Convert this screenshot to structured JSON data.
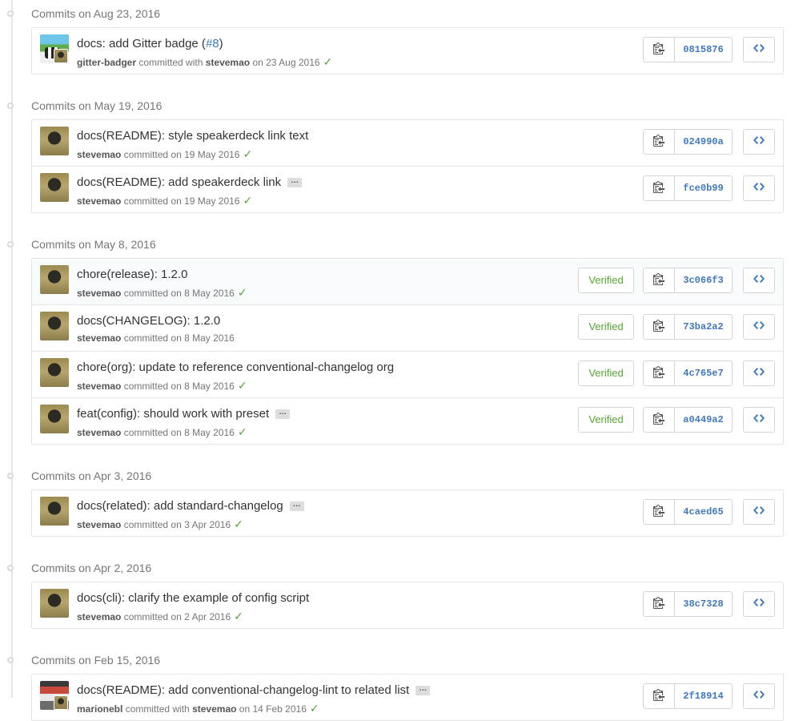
{
  "groups": [
    {
      "header": "Commits on Aug 23, 2016",
      "commits": [
        {
          "avatar": "gitter-badger",
          "title": "docs: add Gitter badge (",
          "issue": "#8",
          "title_suffix": ")",
          "expander": false,
          "author": "gitter-badger",
          "action": "committed with",
          "coauthor": "stevemao",
          "date": "on 23 Aug 2016",
          "check": true,
          "verified": false,
          "sha": "0815876",
          "highlight": false
        }
      ]
    },
    {
      "header": "Commits on May 19, 2016",
      "commits": [
        {
          "avatar": "stevemao",
          "title": "docs(README): style speakerdeck link text",
          "expander": false,
          "author": "stevemao",
          "action": "committed",
          "date": "on 19 May 2016",
          "check": true,
          "verified": false,
          "sha": "024990a",
          "highlight": false
        },
        {
          "avatar": "stevemao",
          "title": "docs(README): add speakerdeck link",
          "expander": true,
          "author": "stevemao",
          "action": "committed",
          "date": "on 19 May 2016",
          "check": true,
          "verified": false,
          "sha": "fce0b99",
          "highlight": false
        }
      ]
    },
    {
      "header": "Commits on May 8, 2016",
      "commits": [
        {
          "avatar": "stevemao",
          "title": "chore(release): 1.2.0",
          "expander": false,
          "author": "stevemao",
          "action": "committed",
          "date": "on 8 May 2016",
          "check": true,
          "verified": true,
          "sha": "3c066f3",
          "highlight": true
        },
        {
          "avatar": "stevemao",
          "title": "docs(CHANGELOG): 1.2.0",
          "expander": false,
          "author": "stevemao",
          "action": "committed",
          "date": "on 8 May 2016",
          "check": false,
          "verified": true,
          "sha": "73ba2a2",
          "highlight": false
        },
        {
          "avatar": "stevemao",
          "title": "chore(org): update to reference conventional-changelog org",
          "expander": false,
          "author": "stevemao",
          "action": "committed",
          "date": "on 8 May 2016",
          "check": true,
          "verified": true,
          "sha": "4c765e7",
          "highlight": false
        },
        {
          "avatar": "stevemao",
          "title": "feat(config): should work with preset",
          "expander": true,
          "author": "stevemao",
          "action": "committed",
          "date": "on 8 May 2016",
          "check": true,
          "verified": true,
          "sha": "a0449a2",
          "highlight": false
        }
      ]
    },
    {
      "header": "Commits on Apr 3, 2016",
      "commits": [
        {
          "avatar": "stevemao",
          "title": "docs(related): add standard-changelog",
          "expander": true,
          "author": "stevemao",
          "action": "committed",
          "date": "on 3 Apr 2016",
          "check": true,
          "verified": false,
          "sha": "4caed65",
          "highlight": false
        }
      ]
    },
    {
      "header": "Commits on Apr 2, 2016",
      "commits": [
        {
          "avatar": "stevemao",
          "title": "docs(cli): clarify the example of config script",
          "expander": false,
          "author": "stevemao",
          "action": "committed",
          "date": "on 2 Apr 2016",
          "check": true,
          "verified": false,
          "sha": "38c7328",
          "highlight": false
        }
      ]
    },
    {
      "header": "Commits on Feb 15, 2016",
      "commits": [
        {
          "avatar": "marionebl",
          "title": "docs(README): add conventional-changelog-lint to related list",
          "expander": true,
          "author": "marionebl",
          "action": "committed with",
          "coauthor": "stevemao",
          "date": "on 14 Feb 2016",
          "check": true,
          "verified": false,
          "sha": "2f18914",
          "highlight": false
        }
      ]
    }
  ],
  "labels": {
    "verified": "Verified",
    "expander": "…",
    "check_glyph": "✓"
  },
  "icons": {
    "copy": "clipboard-icon",
    "browse": "code-icon",
    "check": "check-icon"
  },
  "colors": {
    "link": "#4078c0",
    "success": "#55a532",
    "muted": "#767676"
  }
}
